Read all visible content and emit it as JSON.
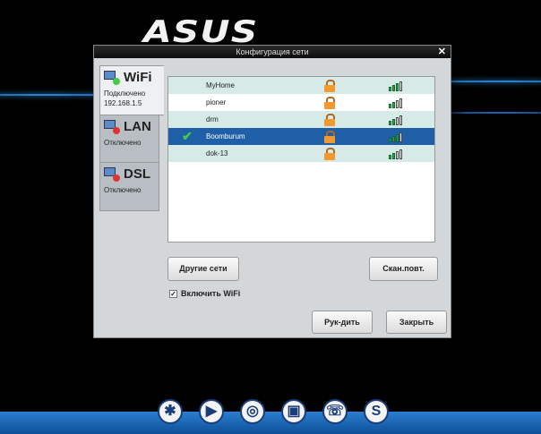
{
  "logo": "ASUS",
  "dialog": {
    "title": "Конфигурация сети",
    "close": "✕"
  },
  "tabs": [
    {
      "name": "WiFi",
      "status": "Подключено",
      "ip": "192.168.1.5"
    },
    {
      "name": "LAN",
      "status": "Отключено"
    },
    {
      "name": "DSL",
      "status": "Отключено"
    }
  ],
  "networks": [
    {
      "ssid": "MyHome",
      "locked": true,
      "signal": 3,
      "connected": false
    },
    {
      "ssid": "pioner",
      "locked": true,
      "signal": 2,
      "connected": false
    },
    {
      "ssid": "drm",
      "locked": true,
      "signal": 2,
      "connected": false
    },
    {
      "ssid": "Boomburum",
      "locked": true,
      "signal": 3,
      "connected": true
    },
    {
      "ssid": "dok-13",
      "locked": true,
      "signal": 2,
      "connected": false
    }
  ],
  "buttons": {
    "other": "Другие сети",
    "rescan": "Скан.повт.",
    "manual": "Рук-дить",
    "close": "Закрыть"
  },
  "wifi_toggle": {
    "label": "Включить WiFi",
    "checked": true
  },
  "colors": {
    "selected": "#1f5fa8",
    "taskbar": "#2a7fd0"
  },
  "taskbar_icons": [
    "asterisk-icon",
    "media-player-icon",
    "game-icon",
    "photo-icon",
    "chat-icon",
    "skype-icon"
  ],
  "taskbar_glyphs": [
    "✱",
    "▶",
    "◎",
    "▣",
    "☏",
    "S"
  ]
}
